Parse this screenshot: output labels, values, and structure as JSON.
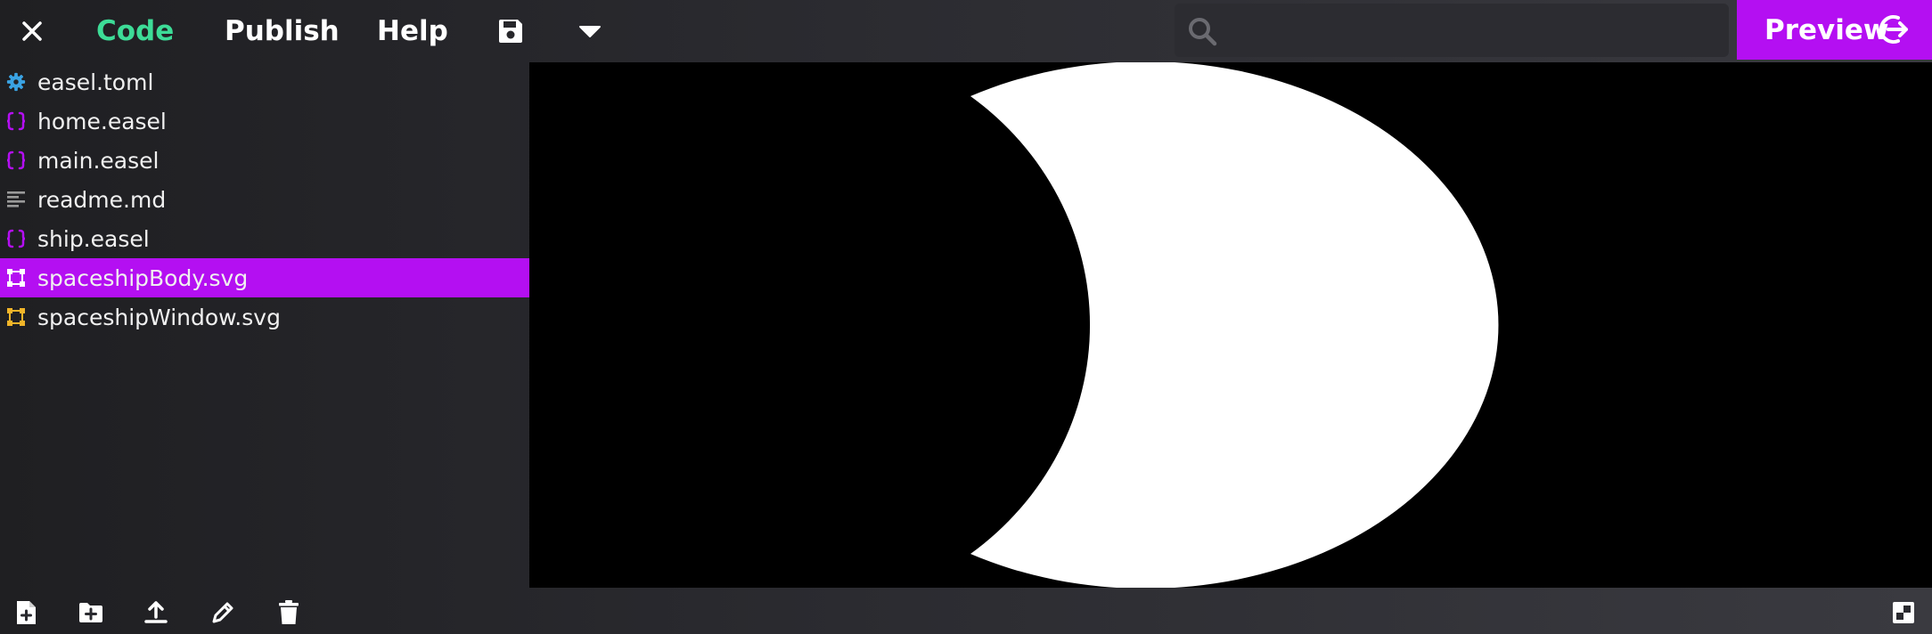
{
  "menu": {
    "code_label": "Code",
    "publish_label": "Publish",
    "help_label": "Help",
    "preview_label": "Preview"
  },
  "search": {
    "value": "",
    "placeholder": ""
  },
  "files": [
    {
      "name": "easel.toml",
      "icon": "gear-icon",
      "icon_color": "#3aa3e3",
      "selected": false
    },
    {
      "name": "home.easel",
      "icon": "code-braces-icon",
      "icon_color": "#b40ff2",
      "selected": false
    },
    {
      "name": "main.easel",
      "icon": "code-braces-icon",
      "icon_color": "#b40ff2",
      "selected": false
    },
    {
      "name": "readme.md",
      "icon": "text-lines-icon",
      "icon_color": "#9a9a9a",
      "selected": false
    },
    {
      "name": "ship.easel",
      "icon": "code-braces-icon",
      "icon_color": "#b40ff2",
      "selected": false
    },
    {
      "name": "spaceshipBody.svg",
      "icon": "vector-shape-icon",
      "icon_color": "#ffffff",
      "selected": true
    },
    {
      "name": "spaceshipWindow.svg",
      "icon": "vector-shape-icon",
      "icon_color": "#f0b429",
      "selected": false
    }
  ],
  "colors": {
    "accent": "#b40ff2",
    "code_tab": "#3ddc97",
    "canvas_bg": "#000000",
    "shape_fill": "#ffffff"
  }
}
